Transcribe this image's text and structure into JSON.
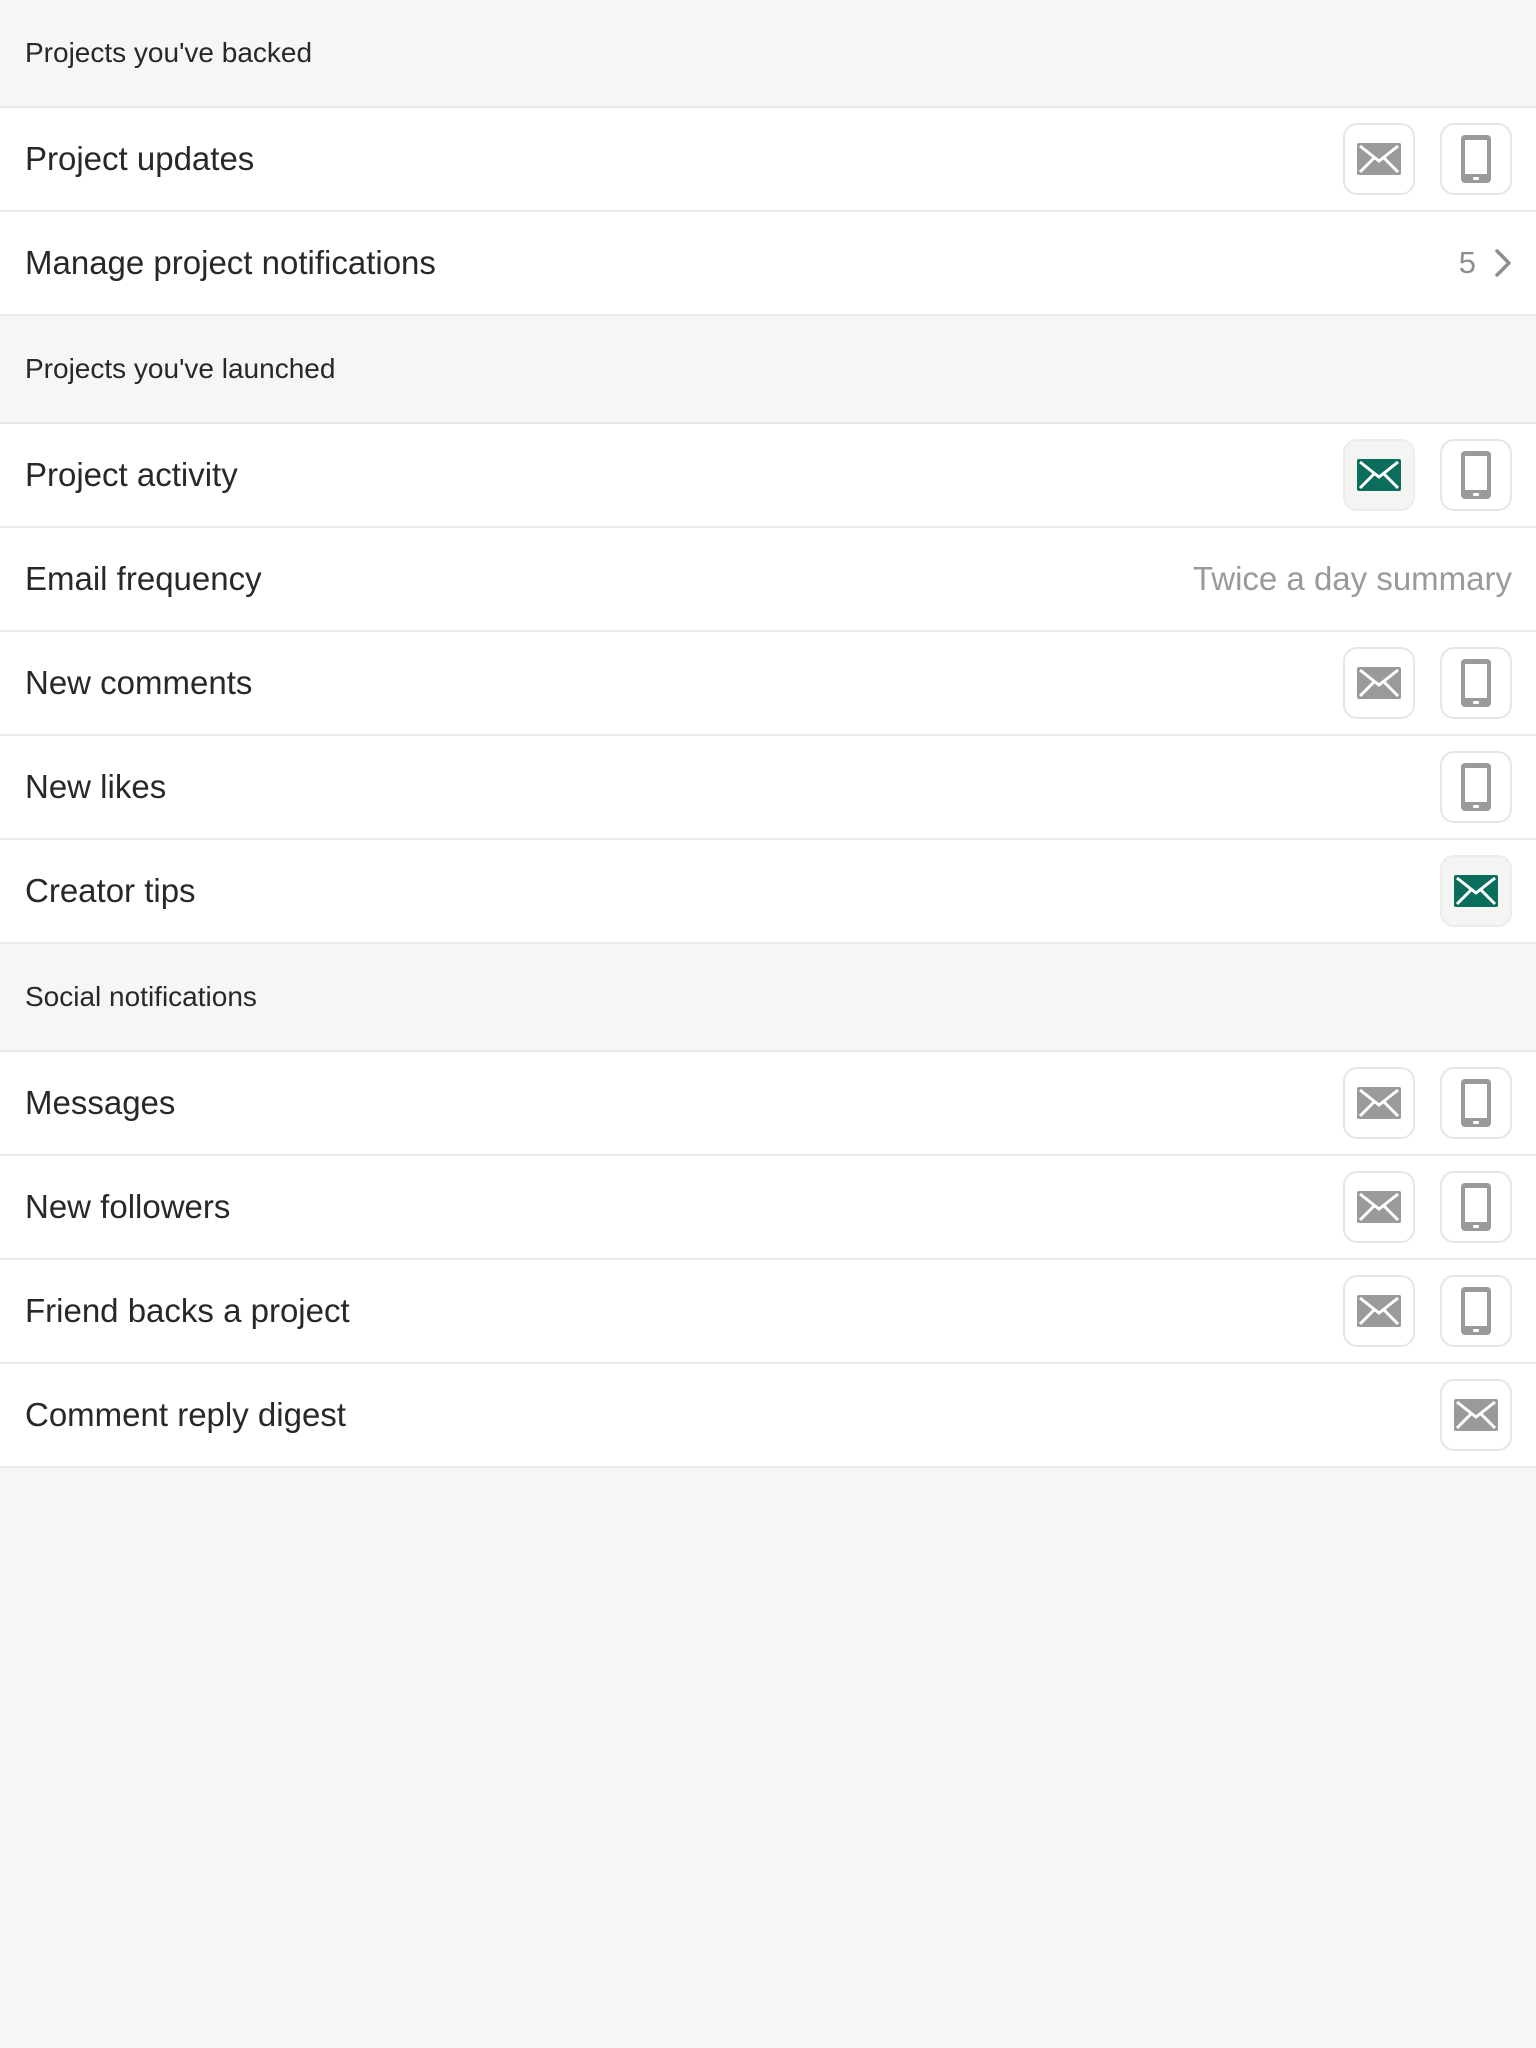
{
  "sections": {
    "backed": {
      "title": "Projects you've backed",
      "project_updates": {
        "label": "Project updates",
        "email_on": false,
        "phone_on": false
      },
      "manage": {
        "label": "Manage project notifications",
        "count": "5"
      }
    },
    "launched": {
      "title": "Projects you've launched",
      "project_activity": {
        "label": "Project activity",
        "email_on": true,
        "phone_on": false
      },
      "email_frequency": {
        "label": "Email frequency",
        "value": "Twice a day summary"
      },
      "new_comments": {
        "label": "New comments",
        "email_on": false,
        "phone_on": false
      },
      "new_likes": {
        "label": "New likes",
        "phone_on": false
      },
      "creator_tips": {
        "label": "Creator tips",
        "email_on": true
      }
    },
    "social": {
      "title": "Social notifications",
      "messages": {
        "label": "Messages",
        "email_on": false,
        "phone_on": false
      },
      "new_followers": {
        "label": "New followers",
        "email_on": false,
        "phone_on": false
      },
      "friend_backs": {
        "label": "Friend backs a project",
        "email_on": false,
        "phone_on": false
      },
      "comment_reply_digest": {
        "label": "Comment reply digest",
        "email_on": false
      }
    }
  },
  "icons": {
    "email": "envelope-icon",
    "phone": "phone-icon",
    "chevron": "chevron-right-icon"
  },
  "colors": {
    "enabled_icon": "#0b6e5c",
    "disabled_icon": "#9a9a9a",
    "background": "#f6f6f4",
    "row_background": "#ffffff",
    "text": "#282828",
    "secondary_text": "#9a9a9a"
  }
}
